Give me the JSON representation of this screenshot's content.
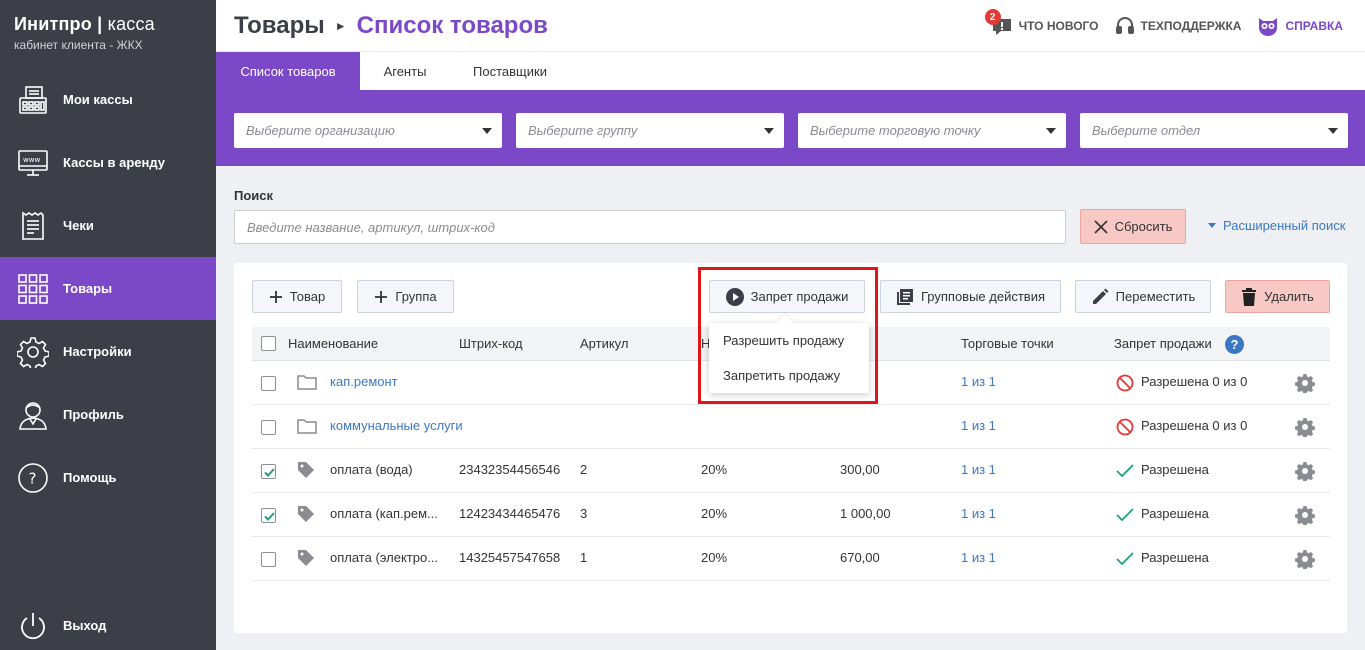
{
  "brand": {
    "name": "Инитпро",
    "product": "касса",
    "subtitle": "кабинет клиента - ЖКХ"
  },
  "sidebar": {
    "items": [
      {
        "label": "Мои кассы",
        "icon": "cash-register-icon"
      },
      {
        "label": "Кассы в аренду",
        "icon": "www-monitor-icon"
      },
      {
        "label": "Чеки",
        "icon": "receipt-icon"
      },
      {
        "label": "Товары",
        "icon": "grid-icon",
        "active": true
      },
      {
        "label": "Настройки",
        "icon": "gear-icon"
      },
      {
        "label": "Профиль",
        "icon": "user-icon"
      },
      {
        "label": "Помощь",
        "icon": "question-icon"
      }
    ],
    "logout": {
      "label": "Выход",
      "icon": "power-icon"
    }
  },
  "header": {
    "crumb_root": "Товары",
    "crumb_current": "Список товаров",
    "links": {
      "news": {
        "label": "ЧТО НОВОГО",
        "badge": "2"
      },
      "support": {
        "label": "ТЕХПОДДЕРЖКА"
      },
      "help": {
        "label": "СПРАВКА"
      }
    }
  },
  "tabs": [
    "Список товаров",
    "Агенты",
    "Поставщики"
  ],
  "filters": {
    "organization": "Выберите организацию",
    "group": "Выберите группу",
    "point": "Выберите торговую точку",
    "department": "Выберите отдел"
  },
  "search": {
    "label": "Поиск",
    "placeholder": "Введите название, артикул, штрих-код",
    "reset": "Сбросить",
    "advanced": "Расширенный поиск"
  },
  "toolbar": {
    "add_item": "Товар",
    "add_group": "Группа",
    "ban_sale": "Запрет продажи",
    "group_actions": "Групповые действия",
    "move": "Переместить",
    "delete": "Удалить"
  },
  "dropdown": {
    "allow": "Разрешить продажу",
    "forbid": "Запретить продажу"
  },
  "table": {
    "headers": {
      "name": "Наименование",
      "barcode": "Штрих-код",
      "article": "Артикул",
      "tax": "Н",
      "price": "",
      "points": "Торговые точки",
      "ban": "Запрет продажи"
    },
    "rows": [
      {
        "type": "group",
        "checked": false,
        "name": "кап.ремонт",
        "barcode": "",
        "article": "",
        "tax": "",
        "price": "",
        "points": "1 из 1",
        "status": "Разрешена 0 из 0",
        "status_kind": "banned"
      },
      {
        "type": "group",
        "checked": false,
        "name": "коммунальные услуги",
        "barcode": "",
        "article": "",
        "tax": "",
        "price": "",
        "points": "1 из 1",
        "status": "Разрешена 0 из 0",
        "status_kind": "banned"
      },
      {
        "type": "item",
        "checked": true,
        "name": "оплата (вода)",
        "barcode": "23432354456546",
        "article": "2",
        "tax": "20%",
        "price": "300,00",
        "points": "1 из 1",
        "status": "Разрешена",
        "status_kind": "ok"
      },
      {
        "type": "item",
        "checked": true,
        "name": "оплата (кап.рем...",
        "barcode": "12423434465476",
        "article": "3",
        "tax": "20%",
        "price": "1 000,00",
        "points": "1 из 1",
        "status": "Разрешена",
        "status_kind": "ok"
      },
      {
        "type": "item",
        "checked": false,
        "name": "оплата (электро...",
        "barcode": "14325457547658",
        "article": "1",
        "tax": "20%",
        "price": "670,00",
        "points": "1 из 1",
        "status": "Разрешена",
        "status_kind": "ok"
      }
    ]
  },
  "colors": {
    "accent": "#7b48c8",
    "sidebar": "#3d3f48",
    "link": "#3a78c3",
    "danger": "#e0141b",
    "success": "#1aa37a"
  }
}
